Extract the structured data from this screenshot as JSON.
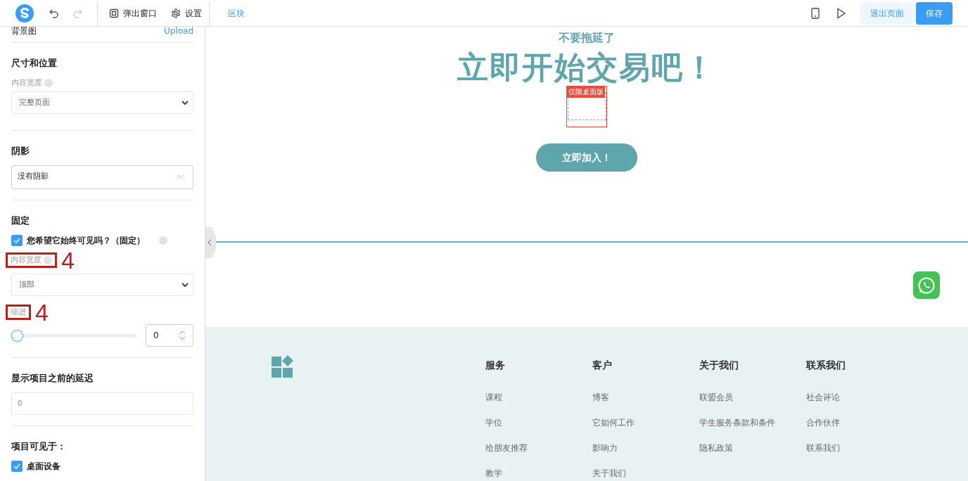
{
  "toolbar": {
    "tools": [
      {
        "kind": "popup",
        "label": "弹出窗口"
      },
      {
        "kind": "gear",
        "label": "设置"
      }
    ],
    "tab": {
      "label": "区块",
      "selected": true
    },
    "undo": {
      "disabled": false
    },
    "redo": {
      "disabled": true
    },
    "exit_button": "退出页面",
    "save_button": "保存"
  },
  "sidebar": {
    "background_label": "背景图",
    "upload_link": "Upload",
    "sections": [
      {
        "title": "尺寸和位置",
        "fields": [
          {
            "kind": "label",
            "text": "内容宽度",
            "help": true
          },
          {
            "kind": "select",
            "value": "完整页面"
          }
        ]
      },
      {
        "title": "阴影",
        "fields": [
          {
            "kind": "dropdown",
            "value": "没有阴影"
          }
        ]
      },
      {
        "title": "固定",
        "fields": [
          {
            "kind": "checkbox",
            "text": "您希望它始终可见吗？（固定）",
            "checked": true,
            "help": true
          },
          {
            "kind": "label",
            "text": "内容宽度",
            "help": true,
            "annotation": "4"
          },
          {
            "kind": "select",
            "value": "顶部"
          },
          {
            "kind": "label",
            "text": "缩进",
            "help": false,
            "annotation": "4"
          },
          {
            "kind": "slider",
            "level": 0,
            "value": "0"
          }
        ]
      },
      {
        "title": "显示项目之前的延迟",
        "fields": [
          {
            "kind": "input",
            "placeholder": "0"
          }
        ]
      },
      {
        "title": "项目可见于：",
        "fields": [
          {
            "kind": "checkbox",
            "text": "桌面设备",
            "checked": true,
            "help": false
          }
        ]
      }
    ]
  },
  "canvas": {
    "subtitle": "不要拖延了",
    "headline": "立即开始交易吧！",
    "desktop_badge": "仅限桌面版",
    "cta_button": "立即加入！",
    "footer": {
      "columns": [
        {
          "title": "服务",
          "links": [
            "课程",
            "学位",
            "给朋友推荐",
            "教学"
          ]
        },
        {
          "title": "客户",
          "links": [
            "博客",
            "它如何工作",
            "影响力",
            "关于我们"
          ]
        },
        {
          "title": "关于我们",
          "links": [
            "联盟会员",
            "学生服务条款和条件",
            "隐私政策"
          ]
        },
        {
          "title": "联系我们",
          "links": [
            "社会评论",
            "合作伙伴",
            "联系我们"
          ]
        }
      ]
    }
  }
}
